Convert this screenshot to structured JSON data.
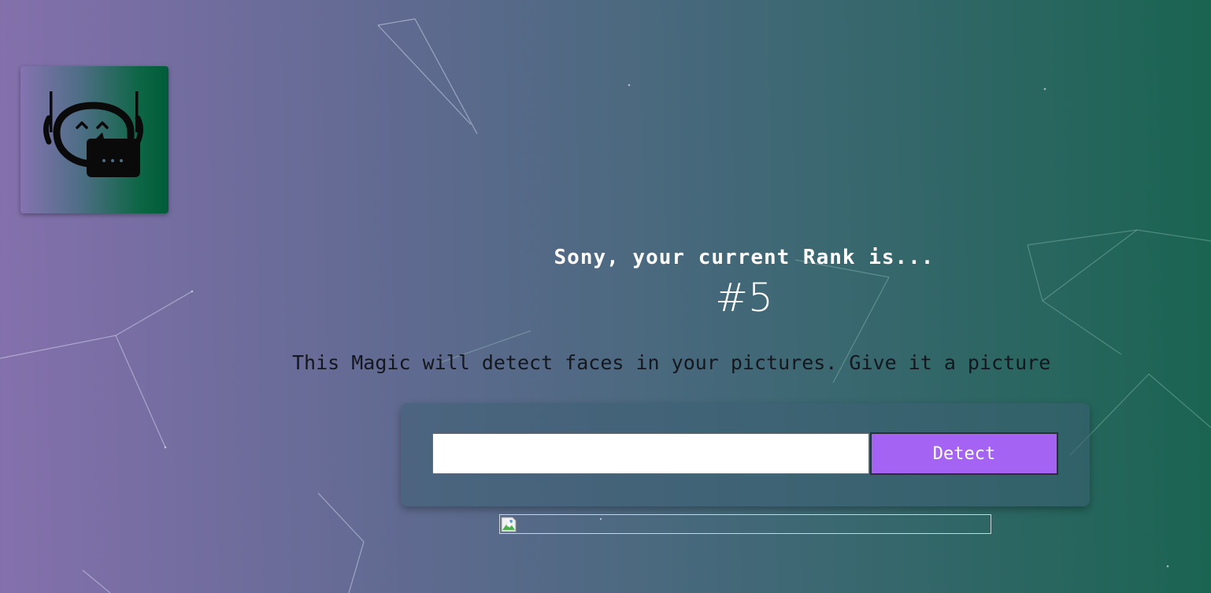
{
  "logo": {
    "icon": "robot-chat-icon"
  },
  "rank": {
    "user_name": "Sony",
    "heading": "Sony, your current Rank is...",
    "value": "#5"
  },
  "description": {
    "text": "This Magic will detect faces in your pictures. Give it a picture"
  },
  "form": {
    "input_value": "",
    "button_label": "Detect"
  },
  "result": {
    "image_icon": "broken-image-icon"
  },
  "colors": {
    "gradient_start": "#8470ad",
    "gradient_end": "#1a6451",
    "button_purple": "#a463f2",
    "description_text": "#15171f"
  }
}
